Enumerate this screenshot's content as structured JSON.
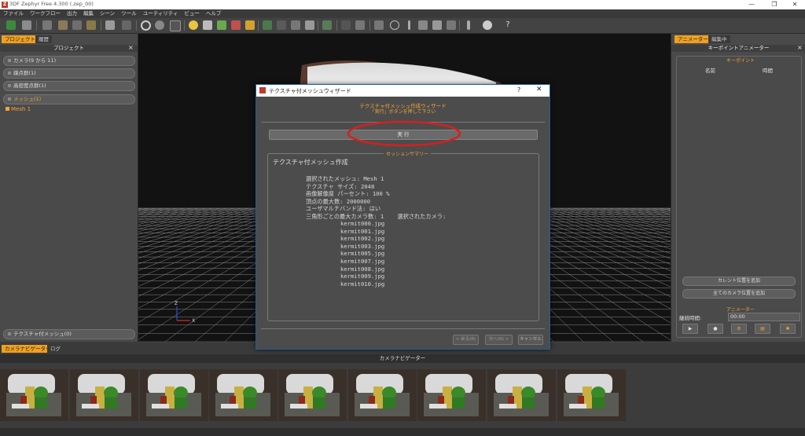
{
  "window": {
    "title": "3DF Zephyr Free 4.300 (.zep_00)",
    "minimize": "—",
    "maximize": "❐",
    "close": "✕"
  },
  "menu": [
    "ファイル",
    "ワークフロー",
    "出力",
    "編集",
    "シーン",
    "ツール",
    "ユーティリティ",
    "ビュー",
    "ヘルプ"
  ],
  "left_panel": {
    "tabs": [
      "プロジェクト",
      "履歴"
    ],
    "header": "プロジェクト",
    "close": "×",
    "groups": [
      "カメラ(9 から 11)",
      "疎点群(1)",
      "高密度点群(1)",
      "メッシュ(1)"
    ],
    "mesh_item": "Mesh 1",
    "bottom_group": "テクスチャ付メッシュ(0)"
  },
  "viewport": {
    "axis_z": "Z",
    "axis_x": "X"
  },
  "right_panel": {
    "tabs": [
      "アニメーター",
      "編集中"
    ],
    "header": "キーポイントアニメーター",
    "close": "×",
    "keypoints_label": "キーポイント",
    "col_name": "名前",
    "col_time": "時間",
    "btn_add_current": "カレント位置を追加",
    "btn_add_all": "全てのカメラ位置を追加",
    "animator_label": "アニメーター",
    "duration_label": "継続時間:",
    "duration_value": "00:00"
  },
  "bottom": {
    "tabs": [
      "カメラナビゲーター",
      "ログ"
    ],
    "navigator_header": "カメラナビゲーター"
  },
  "dialog": {
    "title": "テクスチャ付メッシュウィザード",
    "help": "?",
    "close": "✕",
    "heading": "テクスチャ付メッシュ作成ウィザード",
    "subheading": "「実行」ボタンを押して下さい",
    "run_button": "実 行",
    "summary_legend": "セッションサマリー",
    "summary_title": "テクスチャ付メッシュ作成",
    "summary_lines": [
      "選択されたメッシュ: Mesh 1",
      "テクスチャ サイズ: 2048",
      "画像解像度 パーセント: 100 %",
      "頂点の最大数: 2000000",
      "ユーザマルチバンド法: はい",
      "三角形ごとの最大カメラ数: 1    選択されたカメラ:"
    ],
    "camera_files": [
      "kermit000.jpg",
      "kermit001.jpg",
      "kermit002.jpg",
      "kermit003.jpg",
      "kermit005.jpg",
      "kermit007.jpg",
      "kermit008.jpg",
      "kermit009.jpg",
      "kermit010.jpg"
    ],
    "back_button": "< 戻る(B)",
    "next_button": "次へ(N) >",
    "cancel_button": "キャンセル"
  },
  "colors": {
    "accent": "#f2a33a",
    "annotation_red": "#d42020",
    "dialog_border": "#1f5e9e"
  }
}
